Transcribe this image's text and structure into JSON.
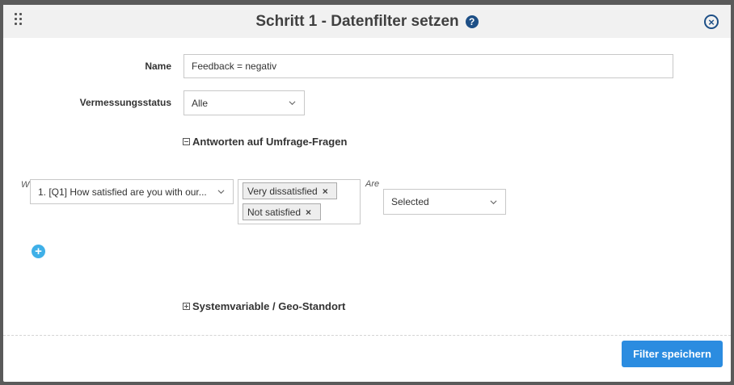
{
  "dialog": {
    "title": "Schritt 1 - Datenfilter setzen",
    "help_symbol": "?",
    "close_symbol": "×"
  },
  "form": {
    "name_label": "Name",
    "name_value": "Feedback = negativ",
    "status_label": "Vermessungsstatus",
    "status_value": "Alle"
  },
  "sections": {
    "survey_answers": "Antworten auf Umfrage-Fragen",
    "system_variables": "Systemvariable / Geo-Standort"
  },
  "condition": {
    "prefix": "W",
    "question": "1. [Q1] How satisfied are you with our...",
    "answers": [
      "Very dissatisfied",
      "Not satisfied"
    ],
    "remove_symbol": "×",
    "operator_label": "Are",
    "operator_value": "Selected"
  },
  "add_symbol": "+",
  "footer": {
    "save_label": "Filter speichern"
  },
  "colors": {
    "primary": "#2b8ce0",
    "add": "#3fb0e8",
    "icon": "#1d4f86"
  }
}
